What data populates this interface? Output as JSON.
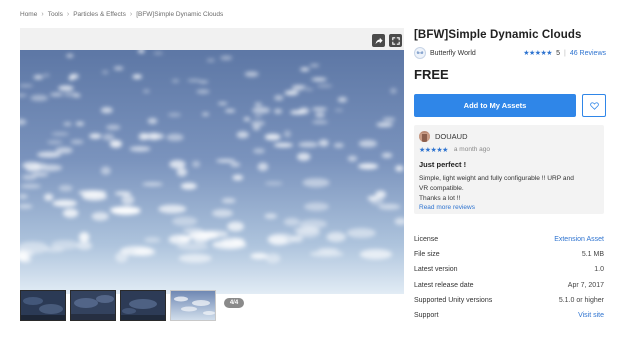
{
  "breadcrumb": [
    "Home",
    "Tools",
    "Particles & Effects",
    "[BFW]Simple Dynamic Clouds"
  ],
  "viewer": {
    "counter": "4/4",
    "thumbnail_count": 4,
    "active_index": 3
  },
  "product": {
    "title": "[BFW]Simple Dynamic Clouds",
    "publisher": "Butterfly World",
    "rating_stars": "★★★★★",
    "rating": "5",
    "reviews_link": "46 Reviews",
    "price": "FREE",
    "add_button": "Add to My Assets"
  },
  "review": {
    "author": "DOUAUD",
    "stars": "★★★★★",
    "date": "a month ago",
    "title": "Just perfect !",
    "body_lines": [
      "Simple, light weight and fully configurable !! URP and",
      "VR compatible.",
      "Thanks a lot !!"
    ],
    "more_link": "Read more reviews"
  },
  "details": [
    {
      "label": "License",
      "value": "Extension Asset",
      "link": true
    },
    {
      "label": "File size",
      "value": "5.1 MB",
      "link": false
    },
    {
      "label": "Latest version",
      "value": "1.0",
      "link": false
    },
    {
      "label": "Latest release date",
      "value": "Apr 7, 2017",
      "link": false
    },
    {
      "label": "Supported Unity versions",
      "value": "5.1.0 or higher",
      "link": false
    },
    {
      "label": "Support",
      "value": "Visit site",
      "link": true
    }
  ],
  "colors": {
    "accent": "#2f86e8",
    "link": "#2f74d0",
    "sky_top": "#5f79a6",
    "sky_bottom": "#dbe7f2"
  },
  "icons": {
    "share": "share-icon",
    "fullscreen": "fullscreen-icon",
    "heart": "heart-outline-icon"
  }
}
